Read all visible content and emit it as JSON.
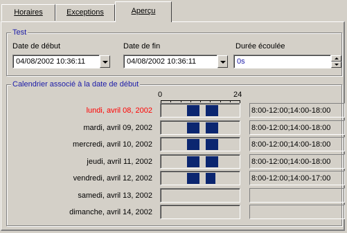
{
  "tabs": [
    {
      "label": "Horaires"
    },
    {
      "label": "Exceptions"
    },
    {
      "label": "Aperçu"
    }
  ],
  "test_group": {
    "title": "Test",
    "start_label": "Date de début",
    "start_value": "04/08/2002 10:36:11",
    "end_label": "Date de fin",
    "end_value": "04/08/2002 10:36:11",
    "elapsed_label": "Durée écoulée",
    "elapsed_value": "0s"
  },
  "calendar_group": {
    "title": "Calendrier associé à la date de début",
    "scale_start": "0",
    "scale_end": "24",
    "scale_hours": 24,
    "highlight_color": "#ff0000",
    "bar_color": "#0b2670",
    "days": [
      {
        "label": "lundi, avril 08, 2002",
        "highlight": true,
        "ranges": "8:00-12:00;14:00-18:00",
        "segments": [
          [
            8,
            12
          ],
          [
            14,
            18
          ]
        ]
      },
      {
        "label": "mardi, avril 09, 2002",
        "highlight": false,
        "ranges": "8:00-12:00;14:00-18:00",
        "segments": [
          [
            8,
            12
          ],
          [
            14,
            18
          ]
        ]
      },
      {
        "label": "mercredi, avril 10, 2002",
        "highlight": false,
        "ranges": "8:00-12:00;14:00-18:00",
        "segments": [
          [
            8,
            12
          ],
          [
            14,
            18
          ]
        ]
      },
      {
        "label": "jeudi, avril 11, 2002",
        "highlight": false,
        "ranges": "8:00-12:00;14:00-18:00",
        "segments": [
          [
            8,
            12
          ],
          [
            14,
            18
          ]
        ]
      },
      {
        "label": "vendredi, avril 12, 2002",
        "highlight": false,
        "ranges": "8:00-12:00;14:00-17:00",
        "segments": [
          [
            8,
            12
          ],
          [
            14,
            17
          ]
        ]
      },
      {
        "label": "samedi, avril 13, 2002",
        "highlight": false,
        "ranges": "",
        "segments": []
      },
      {
        "label": "dimanche, avril 14, 2002",
        "highlight": false,
        "ranges": "",
        "segments": []
      }
    ]
  }
}
